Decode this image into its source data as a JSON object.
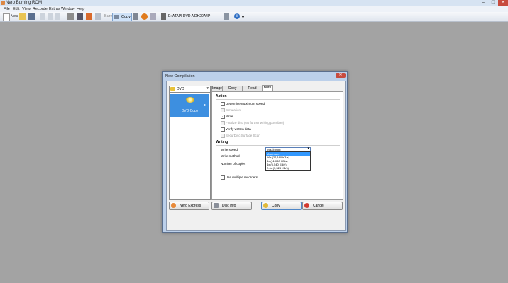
{
  "app": {
    "title": "Nero Burning ROM"
  },
  "menu": [
    "File",
    "Edit",
    "View",
    "Recorder",
    "Extras",
    "Window",
    "Help"
  ],
  "toolbar": {
    "new_label": "New",
    "burn_label": "Burn",
    "copy_label": "Copy",
    "drive": "E: ATAPI DVD A  DH20A4P"
  },
  "dialog": {
    "title": "New Compilation",
    "disc_type": "DVD",
    "compilation": "DVD Copy",
    "tabs": [
      "Image",
      "Copy Options",
      "Read Options",
      "Burn"
    ],
    "action": {
      "heading": "Action",
      "options": [
        {
          "label": "Determine maximum speed",
          "checked": false,
          "enabled": true
        },
        {
          "label": "Simulation",
          "checked": false,
          "enabled": false
        },
        {
          "label": "Write",
          "checked": true,
          "enabled": true
        },
        {
          "label": "Finalize disc (No further writing possible!)",
          "checked": false,
          "enabled": false
        },
        {
          "label": "Verify written data",
          "checked": false,
          "enabled": true
        },
        {
          "label": "SecurDisc Surface Scan",
          "checked": false,
          "enabled": false
        }
      ]
    },
    "writing": {
      "heading": "Writing",
      "write_speed_label": "Write speed",
      "write_speed_value": "Maximum",
      "write_method_label": "Write method",
      "copies_label": "Number of copies",
      "multiple_recorders_label": "Use multiple recorders",
      "speed_options": [
        "Maximum",
        "16x (22,160 KB/s)",
        "8x (11,080 KB/s)",
        "4x (5,540 KB/s)",
        "2.4x (3,324 KB/s)"
      ]
    },
    "buttons": {
      "nero_express": "Nero Express",
      "disc_info": "Disc Info",
      "copy": "Copy",
      "cancel": "Cancel"
    }
  },
  "colors": {
    "selection": "#3399ff",
    "tile": "#3d8fe0",
    "close": "#c74b3e"
  }
}
